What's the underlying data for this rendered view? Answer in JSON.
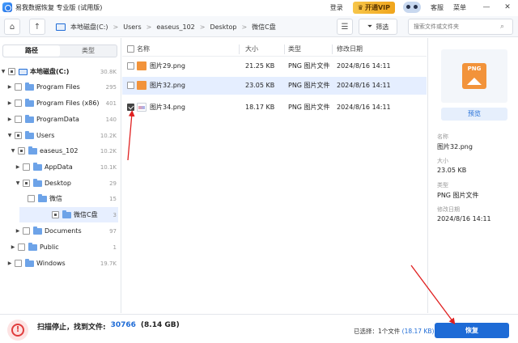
{
  "app": {
    "title": "易我数据恢复 专业版 (试用版)"
  },
  "titlebar": {
    "login": "登录",
    "vip": "开通VIP",
    "service": "客服",
    "menu": "菜单",
    "minimize": "—",
    "close": "✕",
    "vip_icon": "crown-icon"
  },
  "toolbar": {
    "breadcrumbs": [
      "本地磁盘(C:)",
      "Users",
      "easeus_102",
      "Desktop",
      "微信C盘"
    ],
    "filter_label": "筛选",
    "search_placeholder": "搜索文件或文件夹"
  },
  "left": {
    "tabs": [
      {
        "label": "路径",
        "active": true
      },
      {
        "label": "类型",
        "active": false
      }
    ],
    "tree": [
      {
        "label": "本地磁盘(C:)",
        "count": "30.8K",
        "bold": true
      },
      {
        "label": "Program Files",
        "count": "295"
      },
      {
        "label": "Program Files (x86)",
        "count": "401"
      },
      {
        "label": "ProgramData",
        "count": "140"
      },
      {
        "label": "Users",
        "count": "10.2K"
      },
      {
        "label": "easeus_102",
        "count": "10.2K"
      },
      {
        "label": "AppData",
        "count": "10.1K"
      },
      {
        "label": "Desktop",
        "count": "29"
      },
      {
        "label": "微信",
        "count": "15"
      },
      {
        "label": "微信C盘",
        "count": "3"
      },
      {
        "label": "Documents",
        "count": "97"
      },
      {
        "label": "Public",
        "count": "1"
      },
      {
        "label": "Windows",
        "count": "19.7K"
      }
    ]
  },
  "table": {
    "headers": {
      "name": "名称",
      "size": "大小",
      "type": "类型",
      "modified": "修改日期"
    },
    "rows": [
      {
        "name": "图片29.png",
        "size": "21.25 KB",
        "type": "PNG 图片文件",
        "modified": "2024/8/16 14:11",
        "checked": false,
        "selected": false
      },
      {
        "name": "图片32.png",
        "size": "23.05 KB",
        "type": "PNG 图片文件",
        "modified": "2024/8/16 14:11",
        "checked": false,
        "selected": true
      },
      {
        "name": "图片34.png",
        "size": "18.17 KB",
        "type": "PNG 图片文件",
        "modified": "2024/8/16 14:11",
        "checked": true,
        "selected": false
      }
    ]
  },
  "preview": {
    "button": "预览",
    "icon_text": "PNG",
    "name_label": "名称",
    "name_value": "图片32.png",
    "size_label": "大小",
    "size_value": "23.05 KB",
    "type_label": "类型",
    "type_value": "PNG 图片文件",
    "modified_label": "修改日期",
    "modified_value": "2024/8/16 14:11"
  },
  "footer": {
    "status": "扫描停止，找到文件:",
    "found_count": "30766",
    "found_size": "(8.14 GB)",
    "selected_prefix": "已选择：1个文件",
    "selected_size": "(18.17 KB)",
    "recover_label": "恢复"
  },
  "colors": {
    "accent": "#1e6bd6",
    "annotation": "#e02020"
  }
}
